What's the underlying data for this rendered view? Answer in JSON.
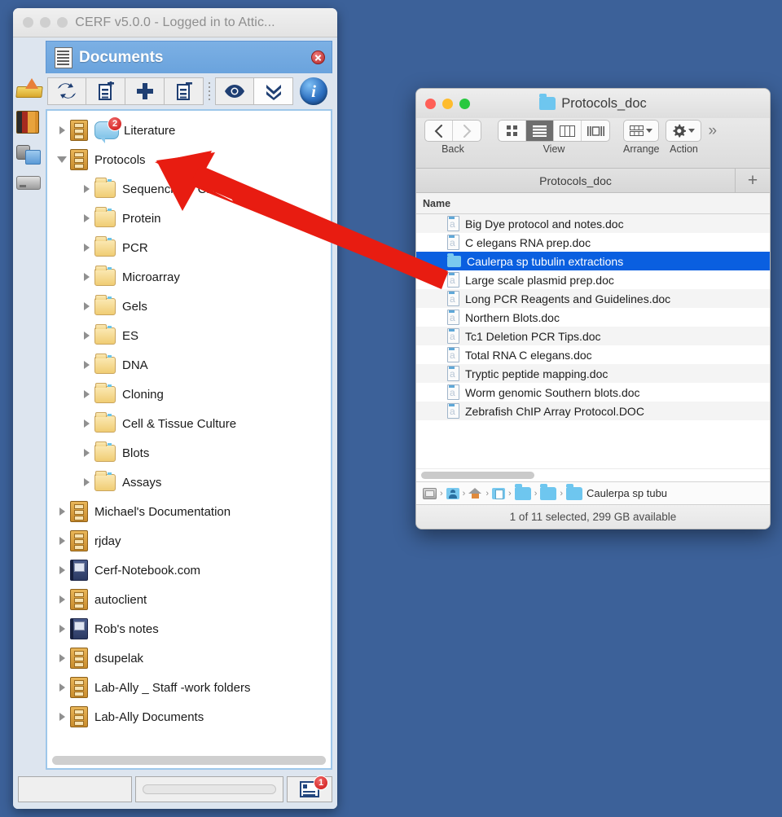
{
  "desktop": {
    "background": "#3c6199"
  },
  "cerf_window": {
    "title": "CERF v5.0.0 - Logged in to Attic...",
    "traffic_lights": [
      "close",
      "minimize",
      "zoom"
    ],
    "panel": {
      "title": "Documents",
      "icon": "document-icon",
      "close_label": "×"
    },
    "rail_icons": [
      {
        "name": "inbox-tray-icon"
      },
      {
        "name": "binder-icon"
      },
      {
        "name": "saved-search-icon"
      },
      {
        "name": "drive-icon"
      }
    ],
    "toolbar": [
      {
        "name": "refresh-sync-button",
        "icon": "sync-arrows-icon"
      },
      {
        "name": "add-cabinet-button",
        "icon": "cabinet-plus-icon"
      },
      {
        "name": "add-item-button",
        "icon": "plus-icon"
      },
      {
        "name": "remove-cabinet-button",
        "icon": "cabinet-minus-icon"
      },
      {
        "name": "view-button",
        "icon": "eye-icon"
      },
      {
        "name": "expand-all-button",
        "icon": "double-chevron-down-icon"
      },
      {
        "name": "info-button",
        "icon": "info-icon",
        "label": "i"
      }
    ],
    "tree": [
      {
        "label": "Literature",
        "icon": "cabinet",
        "indent": 0,
        "twisty": "closed",
        "badge": "2",
        "bubble": true
      },
      {
        "label": "Protocols",
        "icon": "cabinet",
        "indent": 0,
        "twisty": "open"
      },
      {
        "label": "Sequencing - ChIP",
        "icon": "folder",
        "indent": 1,
        "twisty": "closed",
        "obscured": true
      },
      {
        "label": "Protein",
        "icon": "folder",
        "indent": 1,
        "twisty": "closed"
      },
      {
        "label": "PCR",
        "icon": "folder",
        "indent": 1,
        "twisty": "closed"
      },
      {
        "label": "Microarray",
        "icon": "folder",
        "indent": 1,
        "twisty": "closed"
      },
      {
        "label": "Gels",
        "icon": "folder",
        "indent": 1,
        "twisty": "closed"
      },
      {
        "label": "ES",
        "icon": "folder",
        "indent": 1,
        "twisty": "closed"
      },
      {
        "label": "DNA",
        "icon": "folder",
        "indent": 1,
        "twisty": "closed"
      },
      {
        "label": "Cloning",
        "icon": "folder",
        "indent": 1,
        "twisty": "closed"
      },
      {
        "label": "Cell & Tissue Culture",
        "icon": "folder",
        "indent": 1,
        "twisty": "closed"
      },
      {
        "label": "Blots",
        "icon": "folder",
        "indent": 1,
        "twisty": "closed"
      },
      {
        "label": "Assays",
        "icon": "folder",
        "indent": 1,
        "twisty": "closed"
      },
      {
        "label": "Michael's Documentation",
        "icon": "cabinet",
        "indent": 0,
        "twisty": "closed"
      },
      {
        "label": "rjday",
        "icon": "cabinet",
        "indent": 0,
        "twisty": "closed"
      },
      {
        "label": "Cerf-Notebook.com",
        "icon": "notebook",
        "indent": 0,
        "twisty": "closed"
      },
      {
        "label": "autoclient",
        "icon": "cabinet",
        "indent": 0,
        "twisty": "closed"
      },
      {
        "label": "Rob's notes",
        "icon": "notebook",
        "indent": 0,
        "twisty": "closed"
      },
      {
        "label": "dsupelak",
        "icon": "cabinet",
        "indent": 0,
        "twisty": "closed"
      },
      {
        "label": "Lab-Ally _ Staff -work folders",
        "icon": "cabinet",
        "indent": 0,
        "twisty": "closed"
      },
      {
        "label": "Lab-Ally Documents",
        "icon": "cabinet",
        "indent": 0,
        "twisty": "closed"
      }
    ],
    "status_bar": {
      "left_field": "",
      "progress": "",
      "notification_badge": "1",
      "notification_icon": "mini-document-icon"
    }
  },
  "finder_window": {
    "title": "Protocols_doc",
    "title_icon": "folder-icon",
    "traffic_lights": {
      "close": "#ff5f57",
      "minimize": "#febc2e",
      "zoom": "#28c840"
    },
    "toolbar": {
      "back_label": "Back",
      "back_icon": "chevron-left-icon",
      "forward_icon": "chevron-right-icon",
      "view_label": "View",
      "view_options": [
        "icon-view",
        "list-view",
        "column-view",
        "gallery-view"
      ],
      "view_selected": "list-view",
      "arrange_label": "Arrange",
      "arrange_icon": "arrange-grid-icon",
      "action_label": "Action",
      "action_icon": "gear-icon",
      "overflow_icon": "double-chevron-right-icon"
    },
    "tab": {
      "label": "Protocols_doc",
      "add_label": "+"
    },
    "column_header": "Name",
    "files": [
      {
        "name": "Big Dye protocol and notes.doc",
        "type": "doc",
        "selected": false
      },
      {
        "name": "C elegans RNA prep.doc",
        "type": "doc",
        "selected": false
      },
      {
        "name": "Caulerpa sp tubulin extractions",
        "type": "folder",
        "selected": true
      },
      {
        "name": "Large scale plasmid prep.doc",
        "type": "doc",
        "selected": false
      },
      {
        "name": "Long PCR Reagents and Guidelines.doc",
        "type": "doc",
        "selected": false
      },
      {
        "name": "Northern Blots.doc",
        "type": "doc",
        "selected": false
      },
      {
        "name": "Tc1 Deletion PCR Tips.doc",
        "type": "doc",
        "selected": false
      },
      {
        "name": "Total RNA C elegans.doc",
        "type": "doc",
        "selected": false
      },
      {
        "name": "Tryptic peptide mapping.doc",
        "type": "doc",
        "selected": false
      },
      {
        "name": "Worm genomic Southern blots.doc",
        "type": "doc",
        "selected": false
      },
      {
        "name": "Zebrafish ChIP Array Protocol.DOC",
        "type": "doc",
        "selected": false
      }
    ],
    "path_bar": [
      {
        "icon": "disk-icon",
        "label": ""
      },
      {
        "icon": "user-icon",
        "label": ""
      },
      {
        "icon": "home-icon",
        "label": ""
      },
      {
        "icon": "documents-folder-icon",
        "label": ""
      },
      {
        "icon": "folder-icon",
        "label": ""
      },
      {
        "icon": "folder-icon",
        "label": ""
      },
      {
        "icon": "folder-icon",
        "label": "Caulerpa sp tubu"
      }
    ],
    "status": "1 of 11 selected, 299 GB available",
    "selection_color": "#0a5fe0"
  },
  "annotation": {
    "arrow": {
      "name": "red-pointer-arrow",
      "color": "#e81c11",
      "points_to": "Protocols"
    }
  }
}
